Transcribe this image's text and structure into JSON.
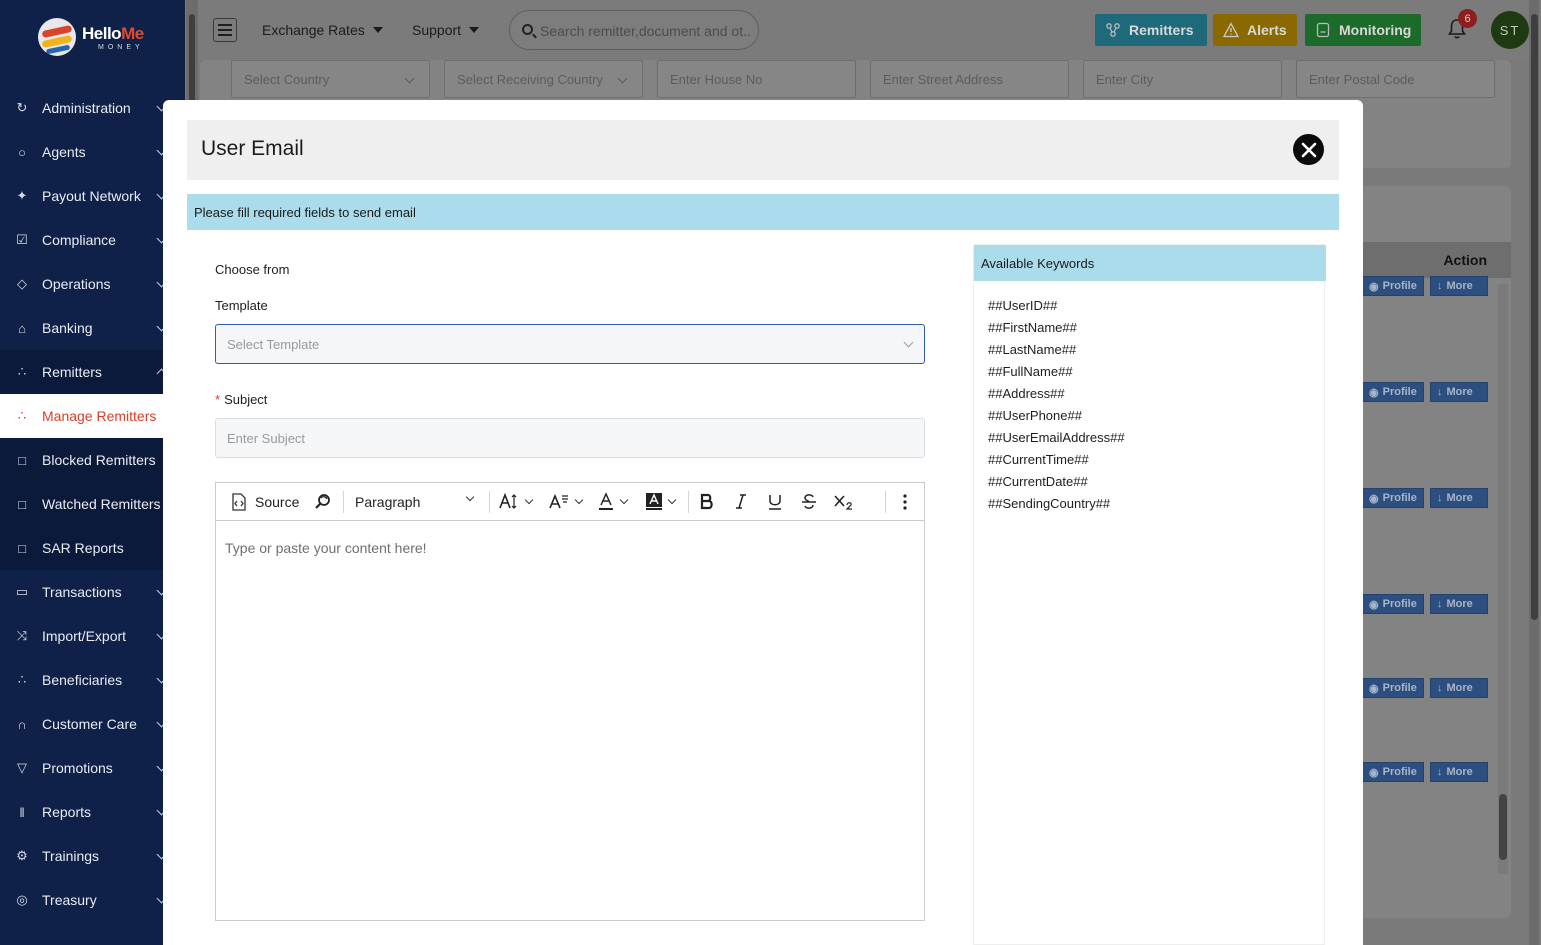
{
  "brand": {
    "logo_hello": "Hello",
    "logo_me": "Me",
    "logo_sub": "MONEY"
  },
  "sidebar": {
    "items": [
      {
        "label": "Administration",
        "icon": "refresh-icon",
        "chevron": "down"
      },
      {
        "label": "Agents",
        "icon": "person-icon",
        "chevron": "down"
      },
      {
        "label": "Payout Network",
        "icon": "handshake-icon",
        "chevron": "down"
      },
      {
        "label": "Compliance",
        "icon": "check-square-icon",
        "chevron": "down"
      },
      {
        "label": "Operations",
        "icon": "tag-icon",
        "chevron": "down"
      },
      {
        "label": "Banking",
        "icon": "bank-icon",
        "chevron": "down"
      },
      {
        "label": "Remitters",
        "icon": "network-icon",
        "chevron": "up"
      },
      {
        "label": "Manage Remitters",
        "icon": "network-icon",
        "selected": true
      },
      {
        "label": "Blocked Remitters",
        "icon": "edit-doc-icon"
      },
      {
        "label": "Watched Remitters",
        "icon": "edit-doc-icon"
      },
      {
        "label": "SAR Reports",
        "icon": "edit-doc-icon"
      },
      {
        "label": "Transactions",
        "icon": "receipt-icon",
        "chevron": "down"
      },
      {
        "label": "Import/Export",
        "icon": "shuffle-icon",
        "chevron": "down"
      },
      {
        "label": "Beneficiaries",
        "icon": "network-icon",
        "chevron": "down"
      },
      {
        "label": "Customer Care",
        "icon": "headset-icon",
        "chevron": "down"
      },
      {
        "label": "Promotions",
        "icon": "basket-icon",
        "chevron": "down"
      },
      {
        "label": "Reports",
        "icon": "bar-chart-icon",
        "chevron": "down"
      },
      {
        "label": "Trainings",
        "icon": "gear-icon",
        "chevron": "down"
      },
      {
        "label": "Treasury",
        "icon": "coin-icon",
        "chevron": "down"
      }
    ]
  },
  "topbar": {
    "exchange_rates": "Exchange Rates",
    "support": "Support",
    "search_placeholder": "Search remitter,document and ot...",
    "remitters": "Remitters",
    "alerts": "Alerts",
    "monitoring": "Monitoring",
    "notifications_count": "6",
    "avatar_initials": "ST",
    "colors": {
      "remitters": "#1f6a7a",
      "alerts": "#8a6a00",
      "monitoring": "#1d6b2a"
    }
  },
  "background": {
    "fields": [
      "Select Country",
      "Select Receiving Country",
      "Enter House No",
      "Enter Street Address",
      "Enter City",
      "Enter Postal Code"
    ],
    "action_header": "Action",
    "row_buttons": {
      "profile": "Profile",
      "more": "More"
    }
  },
  "modal": {
    "title": "User Email",
    "info": "Please fill required fields to send email",
    "choose_from": "Choose from",
    "template_label": "Template",
    "template_placeholder": "Select Template",
    "subject_required": "*",
    "subject_label": "Subject",
    "subject_placeholder": "Enter Subject",
    "editor": {
      "source": "Source",
      "paragraph": "Paragraph",
      "placeholder": "Type or paste your content here!"
    },
    "keywords_title": "Available Keywords",
    "keywords": [
      "##UserID##",
      "##FirstName##",
      "##LastName##",
      "##FullName##",
      "##Address##",
      "##UserPhone##",
      "##UserEmailAddress##",
      "##CurrentTime##",
      "##CurrentDate##",
      "##SendingCountry##"
    ]
  }
}
